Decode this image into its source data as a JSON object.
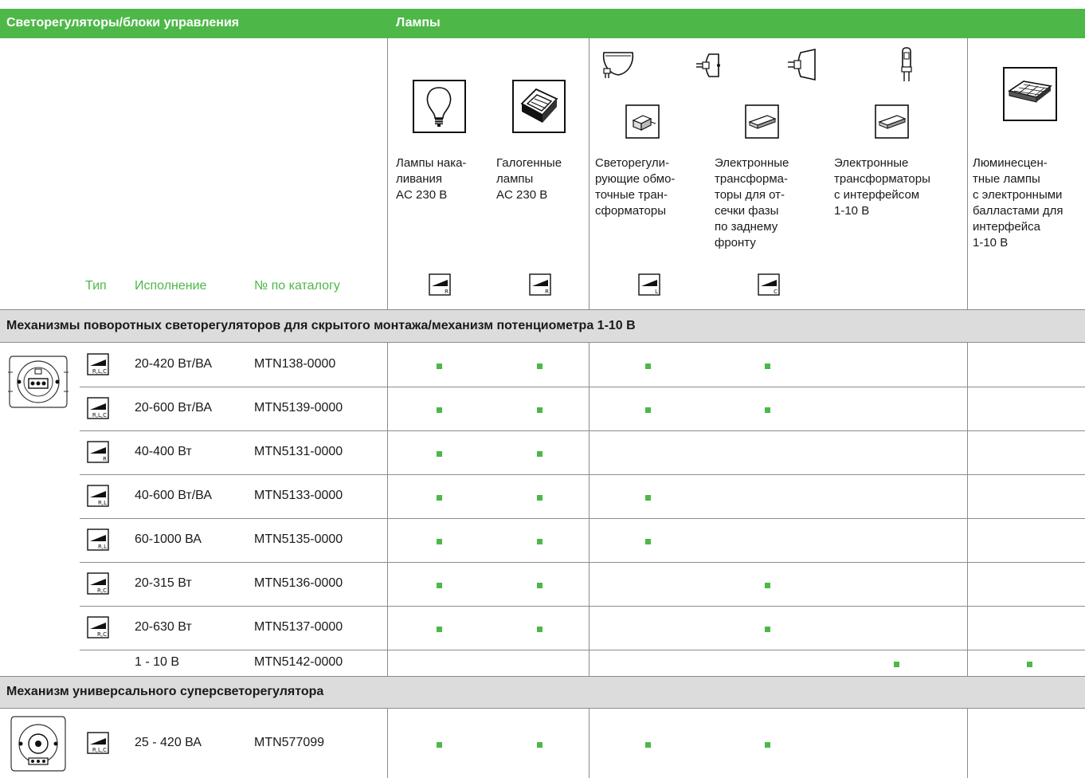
{
  "header": {
    "left_title": "Светорегуляторы/блоки управления",
    "right_title": "Лампы"
  },
  "lamps": [
    {
      "description": "Лампы нака-\nливания\nAC 230 В",
      "icon": "incandescent-bulb-icon",
      "compat_icon": "dimmer-R-icon",
      "compat_letter": "R"
    },
    {
      "description": "Галогенные\nлампы\nAC 230 В",
      "icon": "halogen-lamp-icon",
      "compat_icon": "dimmer-R-icon",
      "compat_letter": "R"
    },
    {
      "description": "Светорегули-\nрующие обмо-\nточные тран-\nсформаторы",
      "icon": "wound-transformer-icon",
      "compat_icon": "dimmer-L-icon",
      "compat_letter": "L"
    },
    {
      "description": "Электронные\nтрансформа-\nторы для от-\nсечки фазы\nпо заднему\nфронту",
      "icon": "electronic-transformer-icon",
      "compat_icon": "dimmer-C-icon",
      "compat_letter": "C"
    },
    {
      "description": "Электронные\nтрансформаторы\nс интерфейсом\n1-10 В",
      "icon": "electronic-transformer-interface-icon",
      "compat_icon": "",
      "compat_letter": ""
    },
    {
      "description": "Люминесцен-\nтные лампы\nс электронными\nбалластами для\nинтерфейса\n1-10 В",
      "icon": "fluorescent-fixture-icon",
      "compat_icon": "",
      "compat_letter": ""
    }
  ],
  "columns": {
    "type": "Тип",
    "version": "Исполнение",
    "catalog": "№ по каталогу"
  },
  "sections": [
    {
      "title": "Механизмы поворотных светорегуляторов для скрытого монтажа/механизм потенциометра 1-10 В",
      "device_icon": "rotary-dimmer-insert-icon",
      "rows": [
        {
          "type_letters": "R,L,C",
          "rating": "20-420 Вт/ВА",
          "catalog": "MTN138-0000",
          "compat": [
            1,
            1,
            1,
            1,
            0,
            0
          ]
        },
        {
          "type_letters": "R,L,C",
          "rating": "20-600 Вт/ВА",
          "catalog": "MTN5139-0000",
          "compat": [
            1,
            1,
            1,
            1,
            0,
            0
          ]
        },
        {
          "type_letters": "R",
          "rating": "40-400 Вт",
          "catalog": "MTN5131-0000",
          "compat": [
            1,
            1,
            0,
            0,
            0,
            0
          ]
        },
        {
          "type_letters": "R,L",
          "rating": "40-600 Вт/ВА",
          "catalog": "MTN5133-0000",
          "compat": [
            1,
            1,
            1,
            0,
            0,
            0
          ]
        },
        {
          "type_letters": "R,L",
          "rating": "60-1000 ВА",
          "catalog": "MTN5135-0000",
          "compat": [
            1,
            1,
            1,
            0,
            0,
            0
          ]
        },
        {
          "type_letters": "R,C",
          "rating": "20-315 Вт",
          "catalog": "MTN5136-0000",
          "compat": [
            1,
            1,
            0,
            1,
            0,
            0
          ]
        },
        {
          "type_letters": "R,C",
          "rating": "20-630 Вт",
          "catalog": "MTN5137-0000",
          "compat": [
            1,
            1,
            0,
            1,
            0,
            0
          ]
        },
        {
          "type_letters": "",
          "rating": "1 - 10 В",
          "catalog": "MTN5142-0000",
          "compat": [
            0,
            0,
            0,
            0,
            1,
            1
          ]
        }
      ]
    },
    {
      "title": "Механизм универсального суперсветорегулятора",
      "device_icon": "universal-dimmer-insert-icon",
      "rows": [
        {
          "type_letters": "R,L,C",
          "rating": "25 - 420 ВА",
          "catalog": "MTN577099",
          "compat": [
            1,
            1,
            1,
            1,
            0,
            0
          ]
        }
      ]
    }
  ],
  "colors": {
    "accent": "#4db848",
    "section_bg": "#dcdcdc",
    "grid": "#8c8c8c"
  }
}
